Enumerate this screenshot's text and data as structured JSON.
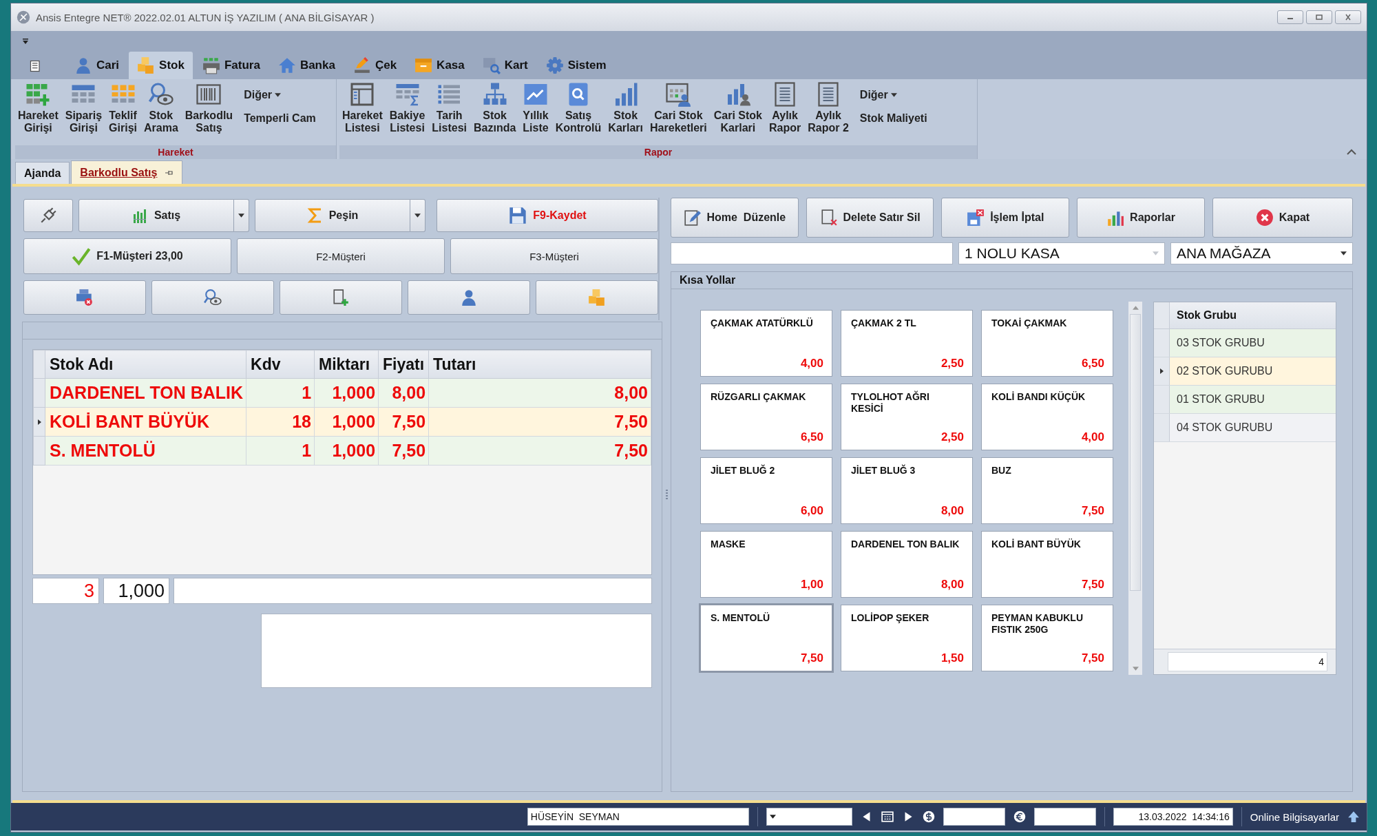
{
  "window": {
    "title": "Ansis Entegre NET® 2022.02.01 ALTUN İŞ YAZILIM ( ANA BİLGİSAYAR )"
  },
  "ribbon_tabs": [
    {
      "label": "Cari",
      "selected": false
    },
    {
      "label": "Stok",
      "selected": true
    },
    {
      "label": "Fatura",
      "selected": false
    },
    {
      "label": "Banka",
      "selected": false
    },
    {
      "label": "Çek",
      "selected": false
    },
    {
      "label": "Kasa",
      "selected": false
    },
    {
      "label": "Kart",
      "selected": false
    },
    {
      "label": "Sistem",
      "selected": false
    }
  ],
  "ribbon_groups": [
    {
      "title": "Hareket",
      "items": [
        {
          "kind": "large",
          "lines": [
            "Hareket",
            "Girişi"
          ]
        },
        {
          "kind": "large",
          "lines": [
            "Sipariş",
            "Girişi"
          ]
        },
        {
          "kind": "large",
          "lines": [
            "Teklif",
            "Girişi"
          ]
        },
        {
          "kind": "large",
          "lines": [
            "Stok",
            "Arama"
          ]
        },
        {
          "kind": "large",
          "lines": [
            "Barkodlu",
            "Satış"
          ]
        },
        {
          "kind": "stack",
          "entries": [
            {
              "label": "Diğer",
              "dropdown": true
            },
            {
              "label": "Temperli Cam",
              "dropdown": false
            }
          ]
        }
      ]
    },
    {
      "title": "Rapor",
      "items": [
        {
          "kind": "large",
          "lines": [
            "Hareket",
            "Listesi"
          ]
        },
        {
          "kind": "large",
          "lines": [
            "Bakiye",
            "Listesi"
          ]
        },
        {
          "kind": "large",
          "lines": [
            "Tarih",
            "Listesi"
          ]
        },
        {
          "kind": "large",
          "lines": [
            "Stok",
            "Bazında"
          ]
        },
        {
          "kind": "large",
          "lines": [
            "Yıllık",
            "Liste"
          ]
        },
        {
          "kind": "large",
          "lines": [
            "Satış",
            "Kontrolü"
          ]
        },
        {
          "kind": "large",
          "lines": [
            "Stok",
            "Karları"
          ]
        },
        {
          "kind": "large",
          "lines": [
            "Cari Stok",
            "Hareketleri"
          ]
        },
        {
          "kind": "large",
          "lines": [
            "Cari Stok",
            "Karlari"
          ]
        },
        {
          "kind": "large",
          "lines": [
            "Aylık",
            "Rapor"
          ]
        },
        {
          "kind": "large",
          "lines": [
            "Aylık",
            "Rapor 2"
          ]
        },
        {
          "kind": "stack",
          "entries": [
            {
              "label": "Diğer",
              "dropdown": true
            },
            {
              "label": "Stok Maliyeti",
              "dropdown": false
            }
          ]
        }
      ]
    }
  ],
  "doc_tabs": [
    {
      "label": "Ajanda",
      "selected": false,
      "pinned": false
    },
    {
      "label": "Barkodlu Satış",
      "selected": true,
      "pinned": true
    }
  ],
  "left_toolbar": [
    [
      {
        "kind": "icon"
      },
      {
        "kind": "split",
        "label": "Satış"
      },
      {
        "kind": "split",
        "label": "Peşin"
      },
      {
        "kind": "plain",
        "label": "F9-Kaydet",
        "alert": true
      }
    ],
    [
      {
        "kind": "plain",
        "label": "F1-Müşteri 23,00",
        "selected": true
      },
      {
        "kind": "plain",
        "label": "F2-Müşteri",
        "selected": false
      },
      {
        "kind": "plain",
        "label": "F3-Müşteri",
        "selected": false
      }
    ],
    [
      {
        "kind": "icon"
      },
      {
        "kind": "icon"
      },
      {
        "kind": "icon"
      },
      {
        "kind": "icon"
      },
      {
        "kind": "icon"
      }
    ]
  ],
  "sales_grid": {
    "columns": [
      "Stok Adı",
      "Kdv",
      "Miktarı",
      "Fiyatı",
      "Tutarı"
    ],
    "rows": [
      {
        "cells": [
          "DARDENEL TON BALIK",
          "1",
          "1,000",
          "8,00",
          "8,00"
        ],
        "selected": false
      },
      {
        "cells": [
          "KOLİ BANT BÜYÜK",
          "18",
          "1,000",
          "7,50",
          "7,50"
        ],
        "selected": true
      },
      {
        "cells": [
          "S. MENTOLÜ",
          "1",
          "1,000",
          "7,50",
          "7,50"
        ],
        "selected": false
      }
    ]
  },
  "totals": {
    "count": "3",
    "quantity": "1,000"
  },
  "right_toolbar": [
    "Home  Düzenle",
    "Delete Satır Sil",
    "İşlem İptal",
    "Raporlar",
    "Kapat"
  ],
  "selectors": [
    {
      "value": "1 NOLU KASA",
      "disabled": true
    },
    {
      "value": "ANA MAĞAZA",
      "disabled": false
    }
  ],
  "shortcuts": {
    "title": "Kısa Yollar",
    "tiles": [
      {
        "name": "ÇAKMAK ATATÜRKLÜ",
        "price": "4,00",
        "selected": false
      },
      {
        "name": "ÇAKMAK 2 TL",
        "price": "2,50",
        "selected": false
      },
      {
        "name": "TOKAİ ÇAKMAK",
        "price": "6,50",
        "selected": false
      },
      {
        "name": "RÜZGARLI ÇAKMAK",
        "price": "6,50",
        "selected": false
      },
      {
        "name": "TYLOLHOT AĞRI KESİCİ",
        "price": "2,50",
        "selected": false
      },
      {
        "name": "KOLİ BANDI KÜÇÜK",
        "price": "4,00",
        "selected": false
      },
      {
        "name": "JİLET BLUĞ 2",
        "price": "6,00",
        "selected": false
      },
      {
        "name": "JİLET BLUĞ 3",
        "price": "8,00",
        "selected": false
      },
      {
        "name": "BUZ",
        "price": "7,50",
        "selected": false
      },
      {
        "name": "MASKE",
        "price": "1,00",
        "selected": false
      },
      {
        "name": "DARDENEL TON BALIK",
        "price": "8,00",
        "selected": false
      },
      {
        "name": "KOLİ BANT BÜYÜK",
        "price": "7,50",
        "selected": false
      },
      {
        "name": "S. MENTOLÜ",
        "price": "7,50",
        "selected": true
      },
      {
        "name": "LOLİPOP ŞEKER",
        "price": "1,50",
        "selected": false
      },
      {
        "name": "PEYMAN KABUKLU FISTIK 250G",
        "price": "7,50",
        "selected": false
      }
    ]
  },
  "stock_groups": {
    "column": "Stok Grubu",
    "rows": [
      {
        "label": "03 STOK GRUBU",
        "selected": false
      },
      {
        "label": "02 STOK GURUBU",
        "selected": true
      },
      {
        "label": "01 STOK GRUBU",
        "selected": false
      },
      {
        "label": "04 STOK GURUBU",
        "selected": false
      }
    ],
    "count": "4"
  },
  "status_bar": {
    "user": "HÜSEYİN  SEYMAN",
    "datetime": "13.03.2022  14:34:16",
    "online": "Online Bilgisayarlar"
  }
}
